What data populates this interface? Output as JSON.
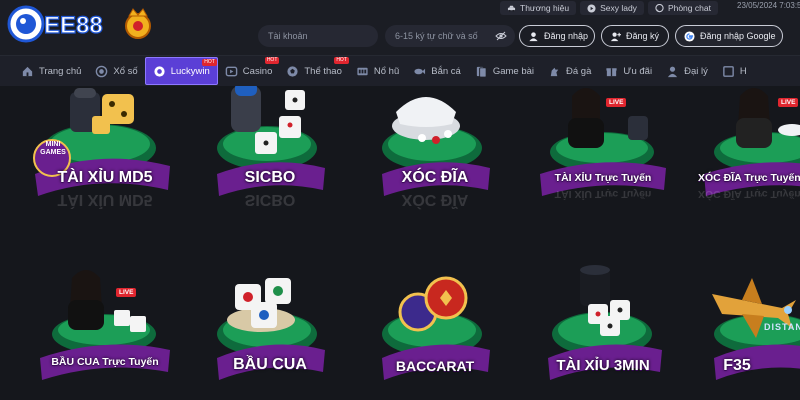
{
  "brand": {
    "logo_text": "EE88"
  },
  "top_links": [
    {
      "label": "Thương hiệu",
      "icon": "car-icon"
    },
    {
      "label": "Sexy lady",
      "icon": "play-circle-icon"
    },
    {
      "label": "Phòng chat",
      "icon": "chat-icon"
    }
  ],
  "datetime": "23/05/2024 7:03:5",
  "login": {
    "username_placeholder": "Tài khoản",
    "password_placeholder": "6-15 ký tự chữ và số",
    "login_label": "Đăng nhập",
    "register_label": "Đăng ký",
    "google_label": "Đăng nhập Google"
  },
  "nav": [
    {
      "label": "Trang chủ",
      "icon": "home-icon",
      "active": false,
      "hot": ""
    },
    {
      "label": "Xổ số",
      "icon": "lottery-icon",
      "active": false,
      "hot": ""
    },
    {
      "label": "Luckywin",
      "icon": "luckywin-icon",
      "active": true,
      "hot": "HOT"
    },
    {
      "label": "Casino",
      "icon": "casino-icon",
      "active": false,
      "hot": "HOT"
    },
    {
      "label": "Thể thao",
      "icon": "sports-icon",
      "active": false,
      "hot": "HOT"
    },
    {
      "label": "Nổ hũ",
      "icon": "slot-icon",
      "active": false,
      "hot": ""
    },
    {
      "label": "Bắn cá",
      "icon": "fish-icon",
      "active": false,
      "hot": ""
    },
    {
      "label": "Game bài",
      "icon": "cards-icon",
      "active": false,
      "hot": ""
    },
    {
      "label": "Đá gà",
      "icon": "rooster-icon",
      "active": false,
      "hot": ""
    },
    {
      "label": "Ưu đãi",
      "icon": "gift-icon",
      "active": false,
      "hot": ""
    },
    {
      "label": "Đại lý",
      "icon": "agent-icon",
      "active": false,
      "hot": ""
    },
    {
      "label": "H",
      "icon": "more-icon",
      "active": false,
      "hot": ""
    }
  ],
  "games": [
    {
      "label": "TÀI XỈU MD5",
      "badge": "MINI GAMES",
      "live": ""
    },
    {
      "label": "SICBO",
      "badge": "",
      "live": ""
    },
    {
      "label": "XÓC ĐĨA",
      "badge": "",
      "live": ""
    },
    {
      "label": "TÀI XỈU Trực Tuyến",
      "badge": "",
      "live": "LIVE"
    },
    {
      "label": "XÓC ĐĨA Trực Tuyến",
      "badge": "",
      "live": "LIVE"
    },
    {
      "label": "BẦU CUA Trực Tuyến",
      "badge": "",
      "live": "LIVE"
    },
    {
      "label": "BẦU CUA",
      "badge": "",
      "live": ""
    },
    {
      "label": "BACCARAT",
      "badge": "",
      "live": ""
    },
    {
      "label": "TÀI XỈU 3MIN",
      "badge": "",
      "live": ""
    },
    {
      "label": "F35",
      "badge": "DISTAN",
      "live": ""
    }
  ],
  "colors": {
    "accent": "#5b3fd6",
    "panel": "#1b1d24",
    "hot": "#e0262f",
    "label_bg": "#6a1f8f"
  }
}
